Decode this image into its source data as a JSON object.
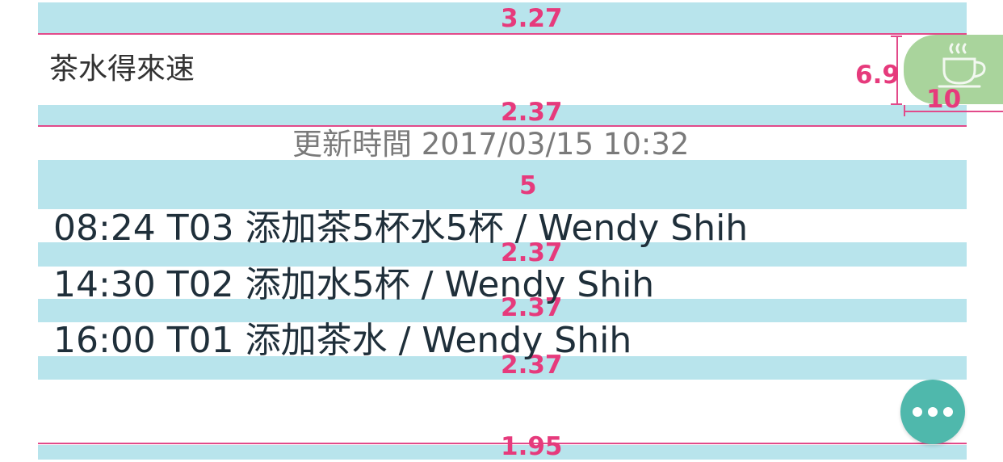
{
  "header": {
    "title": "茶水得來速",
    "icon": "tea-cup-icon"
  },
  "update": {
    "text": "更新時間 2017/03/15 10:32"
  },
  "log_entries": [
    "08:24 T03 添加茶5杯水5杯 / Wendy Shih",
    "14:30 T02 添加水5杯 / Wendy Shih",
    "16:00 T01 添加茶水 / Wendy Shih"
  ],
  "fab": {
    "icon": "more-dots-icon"
  },
  "measurements": {
    "top_margin": "3.27",
    "header_bottom": "2.37",
    "icon_height": "6.9",
    "icon_width": "10",
    "update_gap": "5",
    "row1_gap": "2.37",
    "row2_gap": "2.37",
    "row3_gap": "2.37",
    "bottom_margin": "1.95"
  },
  "colors": {
    "band": "#b8e4ec",
    "measure": "#e63a7c",
    "fab": "#4fb8ac",
    "icon_bg": "#a9d49c"
  }
}
